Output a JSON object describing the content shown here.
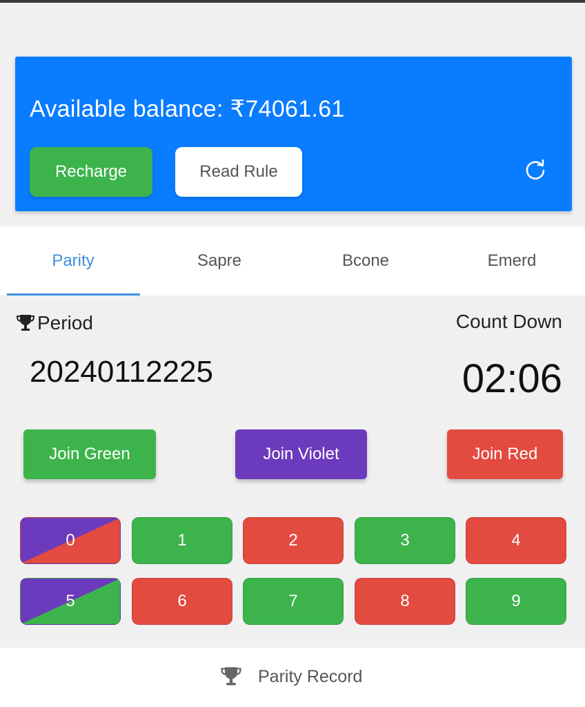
{
  "balance": {
    "text": "Available balance: ₹74061.61",
    "recharge_label": "Recharge",
    "rule_label": "Read Rule"
  },
  "tabs": [
    {
      "label": "Parity",
      "active": true
    },
    {
      "label": "Sapre",
      "active": false
    },
    {
      "label": "Bcone",
      "active": false
    },
    {
      "label": "Emerd",
      "active": false
    }
  ],
  "period": {
    "label": "Period",
    "value": "20240112225"
  },
  "countdown": {
    "label": "Count Down",
    "value": "02:06"
  },
  "join": {
    "green": "Join Green",
    "violet": "Join Violet",
    "red": "Join Red"
  },
  "numbers": [
    {
      "label": "0",
      "color": "violet-red"
    },
    {
      "label": "1",
      "color": "green"
    },
    {
      "label": "2",
      "color": "red"
    },
    {
      "label": "3",
      "color": "green"
    },
    {
      "label": "4",
      "color": "red"
    },
    {
      "label": "5",
      "color": "violet-green"
    },
    {
      "label": "6",
      "color": "red"
    },
    {
      "label": "7",
      "color": "green"
    },
    {
      "label": "8",
      "color": "red"
    },
    {
      "label": "9",
      "color": "green"
    }
  ],
  "record": {
    "label": "Parity Record"
  },
  "colors": {
    "brand_blue": "#0a7cff",
    "green": "#3cb44b",
    "violet": "#6c3bbd",
    "red": "#e34a40",
    "tab_active": "#3d8fe0"
  },
  "icons": {
    "refresh": "refresh-icon",
    "trophy": "trophy-icon"
  }
}
